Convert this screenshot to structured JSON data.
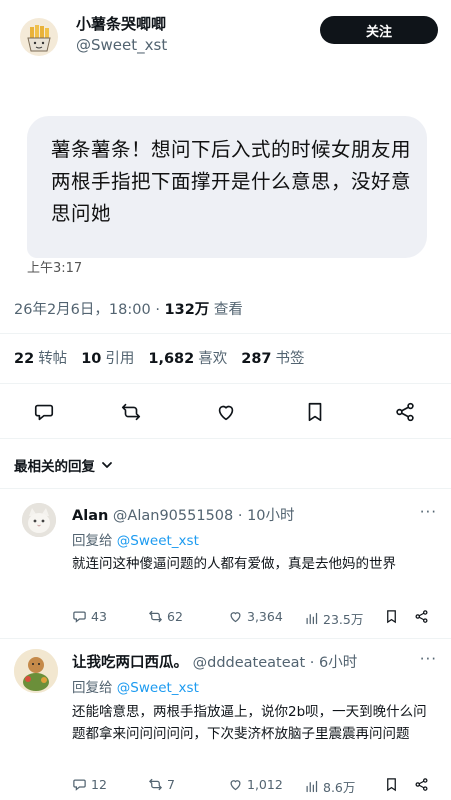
{
  "author": {
    "display_name": "小薯条哭唧唧",
    "handle": "@Sweet_xst",
    "follow_label": "关注"
  },
  "post": {
    "message_text": "薯条薯条！想问下后入式的时候女朋友用两根手指把下面撑开是什么意思，没好意思问她",
    "message_time": "上午3:17",
    "date": "26年2月6日，18:00",
    "dot": "·",
    "views": "132万",
    "views_label": "查看"
  },
  "stats": [
    {
      "count": "22",
      "label": "转帖"
    },
    {
      "count": "10",
      "label": "引用"
    },
    {
      "count": "1,682",
      "label": "喜欢"
    },
    {
      "count": "287",
      "label": "书签"
    }
  ],
  "actions": [
    "reply-icon",
    "retweet-icon",
    "heart-icon",
    "bookmark-icon",
    "share-icon"
  ],
  "sort_label": "最相关的回复",
  "replies": [
    {
      "name": "Alan",
      "handle": "@Alan90551508 · 10小时",
      "more": "···",
      "replying_to_label": "回复给",
      "replying_to_handle": "@Sweet_xst",
      "text": "就连问这种傻逼问题的人都有爱做，真是去他妈的世界",
      "replies": "43",
      "retweets": "62",
      "likes": "3,364",
      "views": "23.5万"
    },
    {
      "name": "让我吃两口西瓜。",
      "handle": "@dddeateateat · 6小时",
      "more": "···",
      "replying_to_label": "回复给",
      "replying_to_handle": "@Sweet_xst",
      "text": "还能啥意思，两根手指放逼上，说你2b呗，一天到晚什么问题都拿来问问问问问，下次斐济杯放脑子里震震再问问题",
      "replies": "12",
      "retweets": "7",
      "likes": "1,012",
      "views": "8.6万"
    }
  ],
  "colors": {
    "link": "#1d9bf0",
    "secondary_text": "#536471",
    "bubble": "#eef0f5",
    "follow_button": "#0f1419"
  }
}
